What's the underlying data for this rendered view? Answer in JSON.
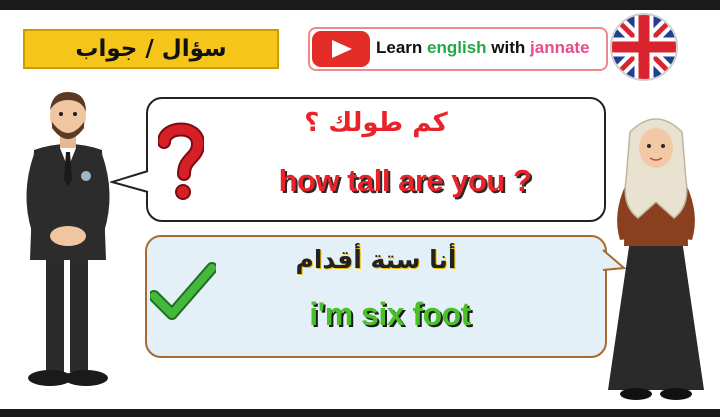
{
  "header": {
    "title": "سؤال / جواب",
    "brand": {
      "word1": "Learn",
      "word2": "english",
      "word3": "with",
      "word4": "jannate"
    }
  },
  "question": {
    "arabic": "كم طولك ؟",
    "english": "how tall are you ?"
  },
  "answer": {
    "arabic": "أنا ستة أقدام",
    "english": "i'm six foot"
  },
  "colors": {
    "question_text": "#e8232a",
    "answer_text": "#4cc02a",
    "title_bg": "#f5c51a",
    "youtube_red": "#e52d27",
    "answer_bubble_bg": "#e4f0f7"
  },
  "icons": [
    "youtube-play-icon",
    "uk-flag-icon",
    "question-mark-icon",
    "check-mark-icon"
  ]
}
